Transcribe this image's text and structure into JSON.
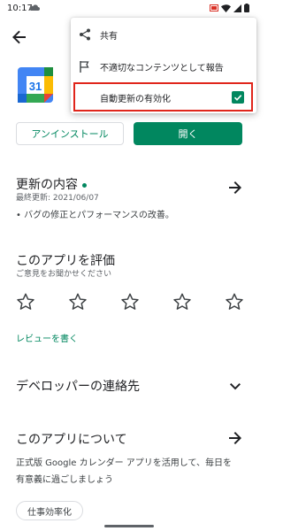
{
  "status_bar": {
    "time": "10:17"
  },
  "app": {
    "icon_number": "31"
  },
  "buttons": {
    "uninstall": "アンインストール",
    "open": "開く"
  },
  "whats_new": {
    "title": "更新の内容",
    "last_updated": "最終更新: 2021/06/07",
    "body": "• バグの修正とパフォーマンスの改善。"
  },
  "rate": {
    "title": "このアプリを評価",
    "subtitle": "ご意見をお聞かせください",
    "write_review": "レビューを書く"
  },
  "developer": {
    "title": "デベロッパーの連絡先"
  },
  "about": {
    "title": "このアプリについて",
    "line1": "正式版 Google カレンダー アプリを活用して、毎日を",
    "line2": "有意義に過ごしましょう",
    "chip": "仕事効率化"
  },
  "menu": {
    "share": "共有",
    "report": "不適切なコンテンツとして報告",
    "auto_update": "自動更新の有効化",
    "auto_update_checked": true
  },
  "colors": {
    "accent_green": "#01875f",
    "highlight_red": "#e0251b"
  }
}
